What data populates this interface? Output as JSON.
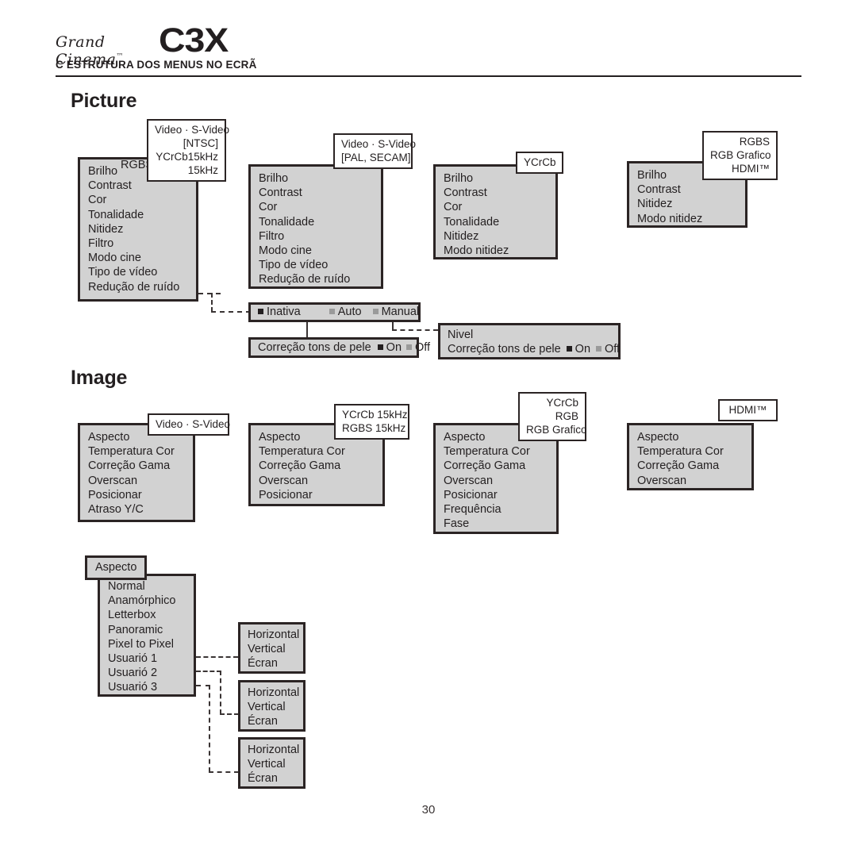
{
  "header": {
    "brand_script": "Grand Cinema",
    "brand_tm": "™",
    "brand_model": "C3X",
    "section_label": "C ESTRUTURA DOS MENUS NO ECRÃ"
  },
  "page_number": "30",
  "sections": [
    {
      "id": "picture",
      "heading": "Picture",
      "menus": [
        {
          "id": "picture-video-ntsc",
          "tag": [
            "Video · S-Video",
            "[NTSC]",
            "YCrCb15kHz",
            "15kHz"
          ],
          "overlay_label": "RGBS",
          "items": [
            "Brilho",
            "Contrast",
            "Cor",
            "Tonalidade",
            "Nitidez",
            "Filtro",
            "Modo cine",
            "Tipo de vídeo",
            "Redução de ruído"
          ]
        },
        {
          "id": "picture-video-pal",
          "tag": [
            "Video · S-Video",
            "[PAL, SECAM]"
          ],
          "items": [
            "Brilho",
            "Contrast",
            "Cor",
            "Tonalidade",
            "Filtro",
            "Modo cine",
            "Tipo de vídeo",
            "Redução de ruído"
          ]
        },
        {
          "id": "picture-ycrcb",
          "tag": [
            "YCrCb"
          ],
          "items": [
            "Brilho",
            "Contrast",
            "Cor",
            "Tonalidade",
            "Nitidez",
            "Modo nitidez"
          ]
        },
        {
          "id": "picture-rgbs-hdmi",
          "tag": [
            "RGBS",
            "RGB Grafico",
            "HDMI™"
          ],
          "items": [
            "Brilho",
            "Contrast",
            "Nitidez",
            "Modo nitidez"
          ]
        }
      ],
      "option_bars": [
        {
          "id": "noise-reduction-modes",
          "options": [
            {
              "label": "Inativa",
              "selected": true
            },
            {
              "label": "Auto",
              "selected": false
            },
            {
              "label": "Manual",
              "selected": false
            }
          ]
        },
        {
          "id": "skin-tone-simple",
          "prefix": "Correção tons de pele",
          "options": [
            {
              "label": "On",
              "selected": true
            },
            {
              "label": "Off",
              "selected": false
            }
          ]
        }
      ],
      "panel": {
        "id": "nivel-panel",
        "title": "Nivel",
        "prefix": "Correção tons de pele",
        "options": [
          {
            "label": "On",
            "selected": true
          },
          {
            "label": "Off",
            "selected": false
          }
        ]
      }
    },
    {
      "id": "image",
      "heading": "Image",
      "menus": [
        {
          "id": "image-video",
          "tag": [
            "Video · S-Video"
          ],
          "items": [
            "Aspecto",
            "Temperatura Cor",
            "Correção Gama",
            "Overscan",
            "Posicionar",
            "Atraso Y/C"
          ]
        },
        {
          "id": "image-ycrcb-rgbs",
          "tag": [
            "YCrCb   15kHz",
            "RGBS   15kHz"
          ],
          "items": [
            "Aspecto",
            "Temperatura Cor",
            "Correção Gama",
            "Overscan",
            "Posicionar"
          ]
        },
        {
          "id": "image-ycrcb-rgb",
          "tag": [
            "YCrCb",
            "RGB",
            "RGB  Grafico"
          ],
          "items": [
            "Aspecto",
            "Temperatura Cor",
            "Correção Gama",
            "Overscan",
            "Posicionar",
            "Frequência",
            "Fase"
          ]
        },
        {
          "id": "image-hdmi",
          "tag": [
            "HDMI™"
          ],
          "items": [
            "Aspecto",
            "Temperatura Cor",
            "Correção Gama",
            "Overscan"
          ]
        }
      ],
      "aspect": {
        "id": "aspecto-submenu",
        "label": "Aspecto",
        "items": [
          "Normal",
          "Anamórphico",
          "Letterbox",
          "Panoramic",
          "Pixel to Pixel",
          "Usuarió 1",
          "Usuarió 2",
          "Usuarió 3"
        ],
        "user_boxes": [
          {
            "id": "user1-adjust",
            "items": [
              "Horizontal",
              "Vertical",
              "Écran"
            ]
          },
          {
            "id": "user2-adjust",
            "items": [
              "Horizontal",
              "Vertical",
              "Écran"
            ]
          },
          {
            "id": "user3-adjust",
            "items": [
              "Horizontal",
              "Vertical",
              "Écran"
            ]
          }
        ]
      }
    }
  ],
  "colors": {
    "menu_fill": "#d2d2d2",
    "menu_border": "#2b2424",
    "tag_fill": "#ffffff",
    "text": "#231f20",
    "dim_bullet": "#9a9a9a"
  }
}
